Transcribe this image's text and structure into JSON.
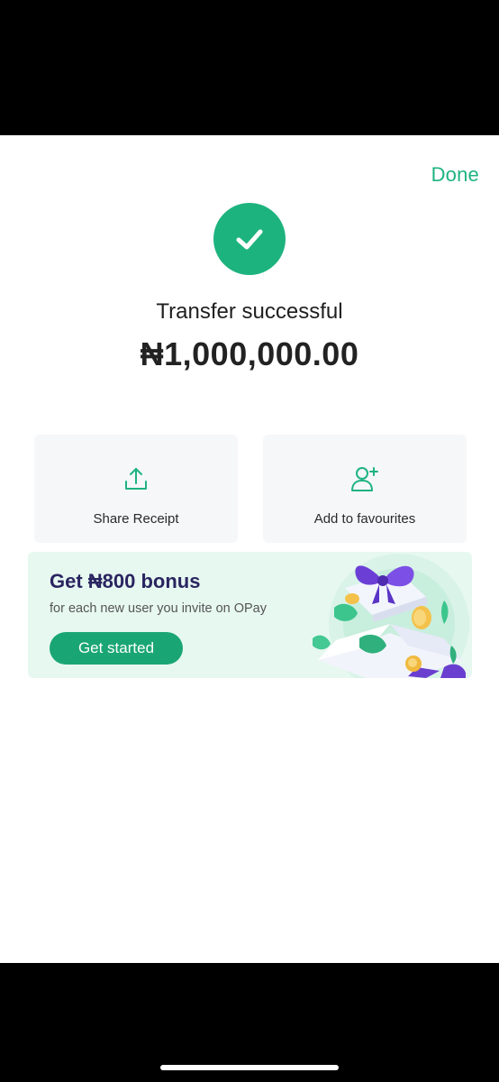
{
  "header": {
    "done_label": "Done"
  },
  "status": {
    "message": "Transfer successful",
    "amount": "₦1,000,000.00",
    "icon": "check-icon"
  },
  "actions": [
    {
      "label": "Share Receipt",
      "icon": "share-icon"
    },
    {
      "label": "Add to favourites",
      "icon": "add-user-icon"
    }
  ],
  "promo": {
    "title": "Get ₦800 bonus",
    "subtitle": "for each new user you invite on OPay",
    "button_label": "Get started"
  },
  "colors": {
    "accent": "#1db37f",
    "banner_bg": "#e7f8f1",
    "promo_title": "#2a2560"
  }
}
